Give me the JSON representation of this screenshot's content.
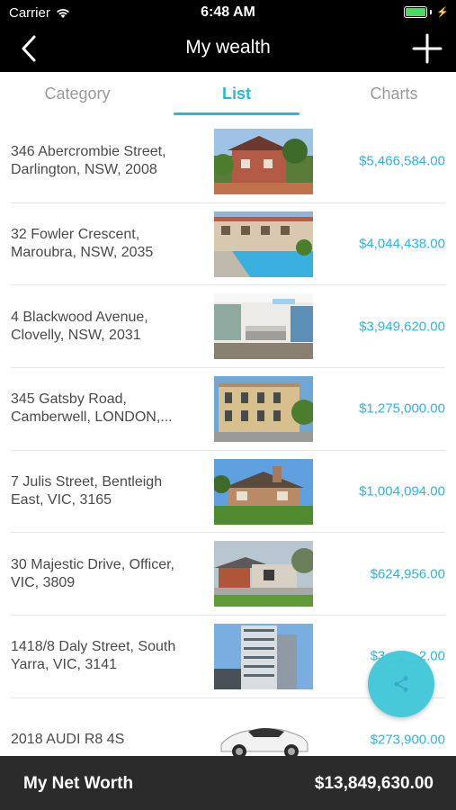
{
  "status_bar": {
    "carrier": "Carrier",
    "time": "6:48 AM",
    "icons": [
      "wifi-icon",
      "battery-icon",
      "charging-bolt-icon"
    ]
  },
  "nav": {
    "title": "My wealth",
    "back_icon": "chevron-left-icon",
    "add_icon": "plus-icon"
  },
  "tabs": [
    {
      "label": "Category"
    },
    {
      "label": "List"
    },
    {
      "label": "Charts"
    }
  ],
  "active_tab": "List",
  "assets": [
    {
      "line1": "346 Abercrombie Street,",
      "line2": "Darlington, NSW, 2008",
      "value": "$5,466,584.00",
      "thumb": "house-photo"
    },
    {
      "line1": "32 Fowler Crescent,",
      "line2": "Maroubra, NSW, 2035",
      "value": "$4,044,438.00",
      "thumb": "pool-photo"
    },
    {
      "line1": "4 Blackwood Avenue,",
      "line2": "Clovelly, NSW, 2031",
      "value": "$3,949,620.00",
      "thumb": "interior-photo"
    },
    {
      "line1": "345 Gatsby Road,",
      "line2": "Camberwell, LONDON,...",
      "value": "$1,275,000.00",
      "thumb": "terrace-photo"
    },
    {
      "line1": "7 Julis Street, Bentleigh",
      "line2": "East, VIC, 3165",
      "value": "$1,004,094.00",
      "thumb": "bungalow-photo"
    },
    {
      "line1": "30 Majestic Drive, Officer,",
      "line2": "VIC, 3809",
      "value": "$624,956.00",
      "thumb": "new-home-photo"
    },
    {
      "line1": "1418/8 Daly Street, South",
      "line2": "Yarra, VIC, 3141",
      "value": "$3__,__2.00",
      "thumb": "tower-photo"
    },
    {
      "line1": "2018 AUDI R8 4S",
      "line2": "",
      "value": "$273,900.00",
      "thumb": "car-photo"
    }
  ],
  "fab": {
    "icon": "share-icon"
  },
  "footer": {
    "label": "My Net Worth",
    "value": "$13,849,630.00"
  },
  "colors": {
    "accent": "#2bb5e0",
    "fab": "#3fc7d8",
    "footer_bg": "#2b2b2b",
    "nav_bg": "#000000"
  }
}
